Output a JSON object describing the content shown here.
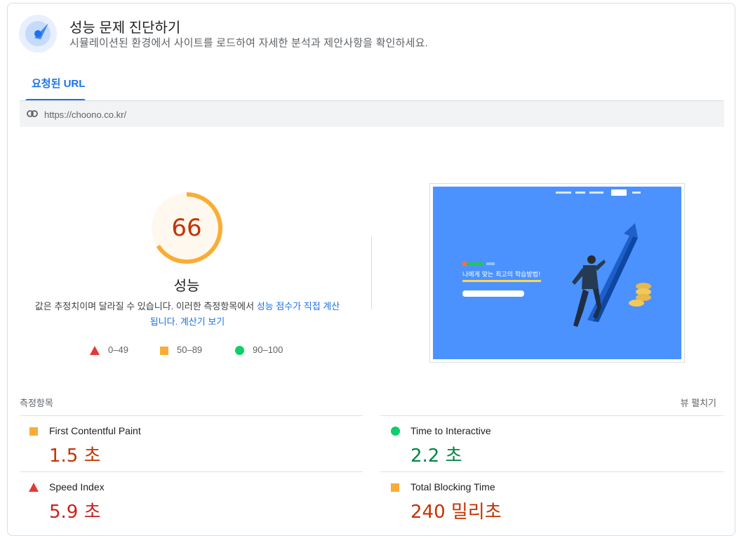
{
  "header": {
    "title": "성능 문제 진단하기",
    "subtitle": "시뮬레이션된 환경에서 사이트를 로드하여 자세한 분석과 제안사항을 확인하세요."
  },
  "tabs": [
    {
      "label": "요청된 URL",
      "active": true
    }
  ],
  "url": "https://choono.co.kr/",
  "score": {
    "value": "66",
    "fraction": 0.66,
    "label": "성능",
    "desc_pre": "값은 추정치이며 달라질 수 있습니다. 이러한 측정항목에서 ",
    "desc_link": "성능 점수가 직접 계산됩니다.",
    "desc_calc": "계산기 보기",
    "color": "#c33300",
    "arc_color": "#fbac34",
    "bg_color": "#fff8ee"
  },
  "legend": [
    {
      "shape": "triangle",
      "label": "0–49",
      "color": "#e53935"
    },
    {
      "shape": "square",
      "label": "50–89",
      "color": "#fbac34"
    },
    {
      "shape": "circle",
      "label": "90–100",
      "color": "#0cce6b"
    }
  ],
  "thumbnail": {
    "headline": "나에게 맞는 최고의 학습방법!"
  },
  "metrics": {
    "title": "측정항목",
    "expand_label": "뷰 펼치기",
    "items": [
      {
        "name": "First Contentful Paint",
        "value": "1.5 초",
        "status": "average",
        "color": "#c33300"
      },
      {
        "name": "Time to Interactive",
        "value": "2.2 초",
        "status": "pass",
        "color": "#018642"
      },
      {
        "name": "Speed Index",
        "value": "5.9 초",
        "status": "fail",
        "color": "#c7221f"
      },
      {
        "name": "Total Blocking Time",
        "value": "240 밀리초",
        "status": "average",
        "color": "#c33300"
      }
    ]
  }
}
